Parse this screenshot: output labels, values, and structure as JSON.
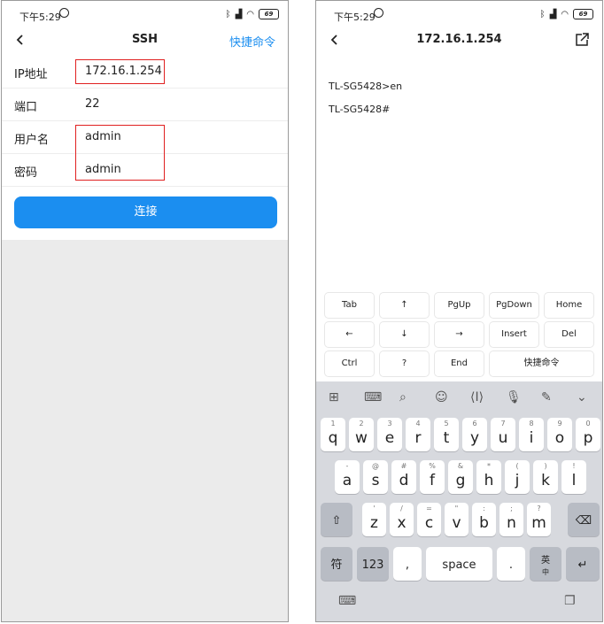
{
  "left": {
    "status": {
      "time": "下午5:29",
      "battery": "69"
    },
    "nav": {
      "title": "SSH",
      "shortcut": "快捷命令"
    },
    "form": {
      "rows": [
        {
          "label": "IP地址",
          "value": "172.16.1.254"
        },
        {
          "label": "端口",
          "value": "22"
        },
        {
          "label": "用户名",
          "value": "admin"
        },
        {
          "label": "密码",
          "value": "admin"
        }
      ]
    },
    "connect_label": "连接"
  },
  "right": {
    "status": {
      "time": "下午5:29",
      "battery": "69"
    },
    "nav": {
      "title": "172.16.1.254"
    },
    "terminal": [
      "TL-SG5428>en",
      "TL-SG5428#"
    ],
    "keypad": [
      [
        "Tab",
        "↑",
        "PgUp",
        "PgDown",
        "Home"
      ],
      [
        "←",
        "↓",
        "→",
        "Insert",
        "Del"
      ],
      [
        "Ctrl",
        "?",
        "End",
        "快捷命令"
      ]
    ],
    "keyboard": {
      "row1": [
        [
          "1",
          "q"
        ],
        [
          "2",
          "w"
        ],
        [
          "3",
          "e"
        ],
        [
          "4",
          "r"
        ],
        [
          "5",
          "t"
        ],
        [
          "6",
          "y"
        ],
        [
          "7",
          "u"
        ],
        [
          "8",
          "i"
        ],
        [
          "9",
          "o"
        ],
        [
          "0",
          "p"
        ]
      ],
      "row2": [
        [
          "-",
          "a"
        ],
        [
          "@",
          "s"
        ],
        [
          "#",
          "d"
        ],
        [
          "%",
          "f"
        ],
        [
          "&",
          "g"
        ],
        [
          "*",
          "h"
        ],
        [
          "(",
          "j"
        ],
        [
          ")",
          "k"
        ],
        [
          "!",
          "l"
        ]
      ],
      "row3": [
        [
          "'",
          "z"
        ],
        [
          "/",
          "x"
        ],
        [
          "=",
          "c"
        ],
        [
          "\"",
          "v"
        ],
        [
          ":",
          "b"
        ],
        [
          ";",
          "n"
        ],
        [
          "?",
          "m"
        ]
      ],
      "sym": "符",
      "num": "123",
      "comma": ",",
      "space": "space",
      "period": ".",
      "lang": "英",
      "lang_sub": "中"
    }
  }
}
